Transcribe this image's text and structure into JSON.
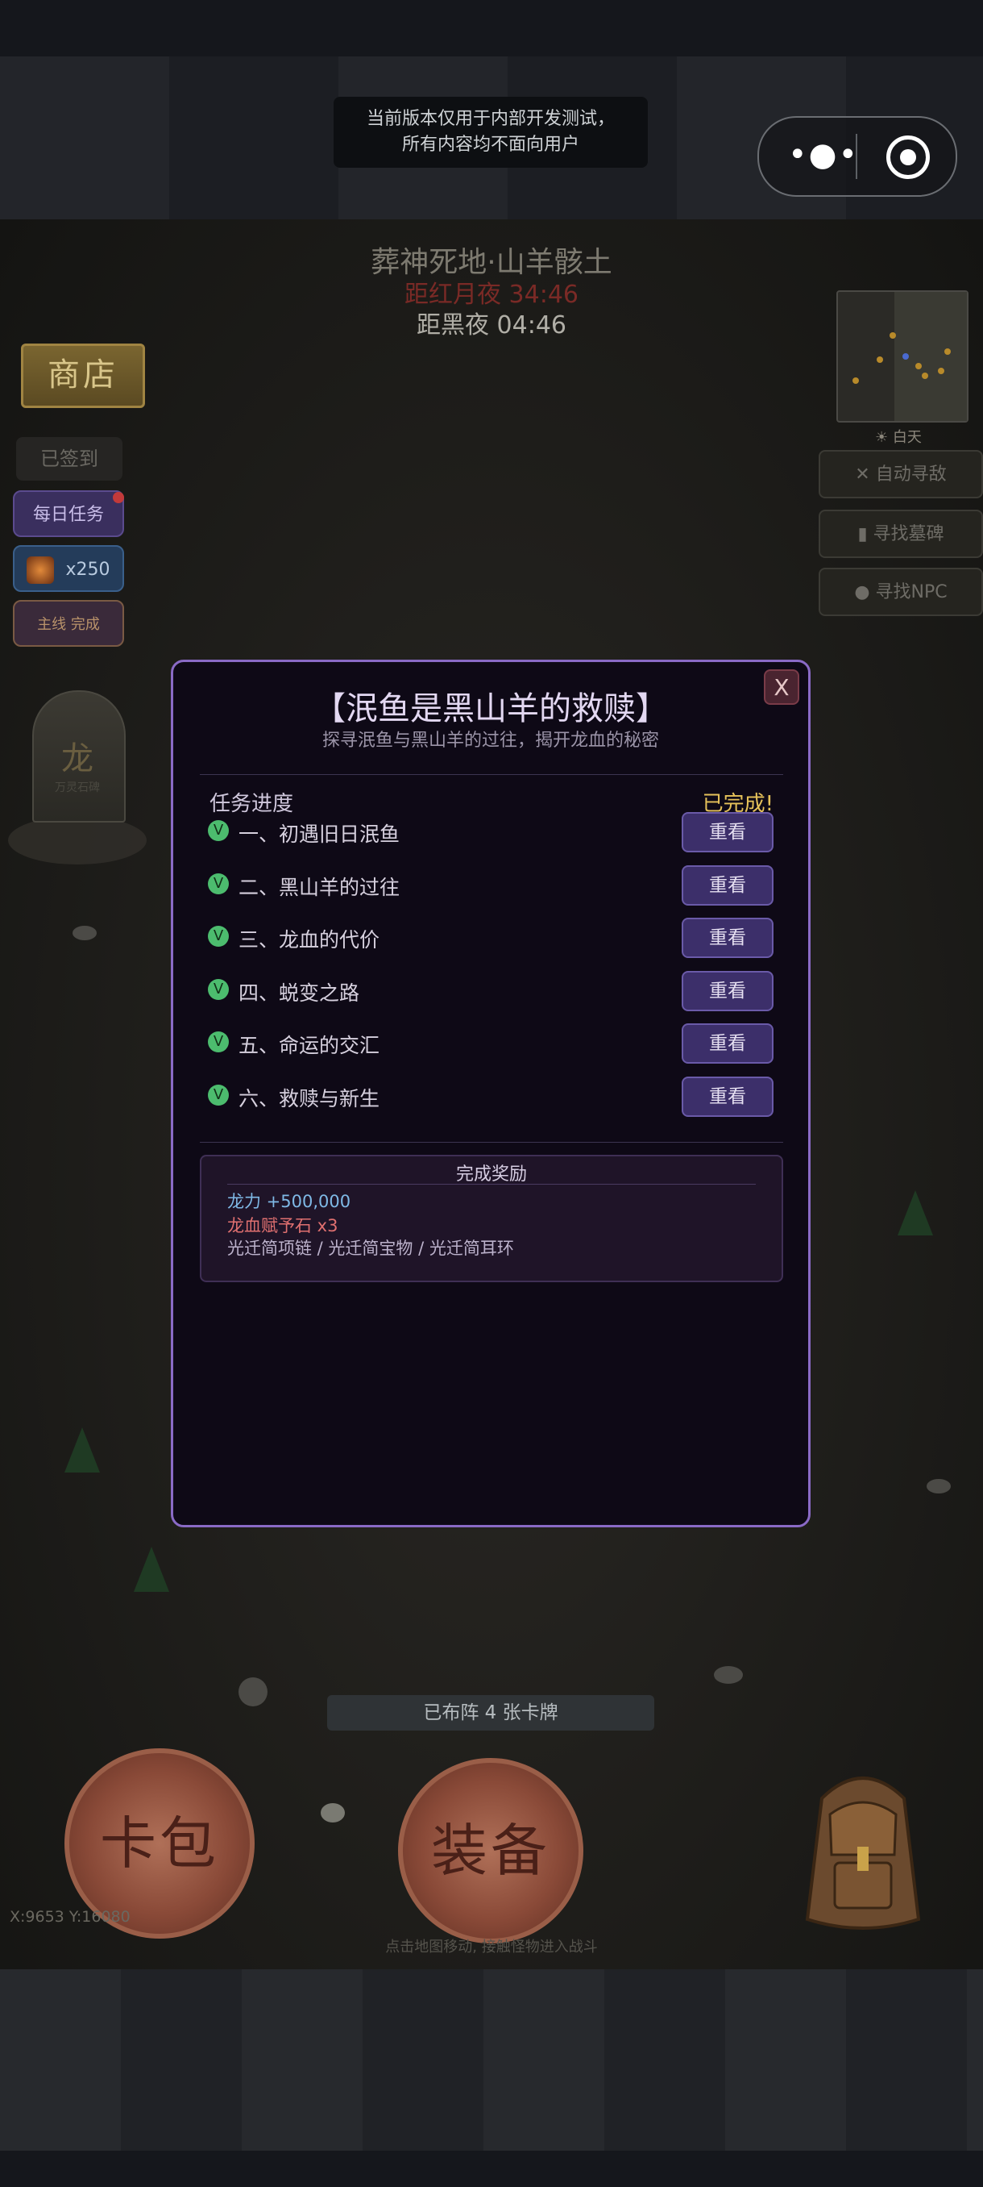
{
  "system": {
    "dev_notice_line1": "当前版本仅用于内部开发测试，",
    "dev_notice_line2": "所有内容均不面向用户",
    "menu_icon": "more-dots-icon",
    "close_icon": "target-icon"
  },
  "hud": {
    "area_name": "葬神死地·山羊骸土",
    "countdown_red": "距红月夜 34:46",
    "countdown_night": "距黑夜 04:46",
    "shop": "商店",
    "signed_in": "已签到",
    "daily_tasks": "每日任务",
    "gem_count": "x250",
    "main_quest": "主线 完成",
    "statue_char": "龙",
    "statue_caption": "万灵石碑",
    "day_label": "☀ 白天",
    "auto_find_enemy": "✕ 自动寻敌",
    "find_grave": "▮ 寻找墓碑",
    "find_npc": "● 寻找NPC"
  },
  "modal": {
    "close": "X",
    "title": "【泯鱼是黑山羊的救赎】",
    "subtitle": "探寻泯鱼与黑山羊的过往，揭开龙血的秘密",
    "progress_label": "任务进度",
    "progress_status": "已完成!",
    "quests": [
      {
        "check": "V",
        "name": "一、初遇旧日泯鱼",
        "button": "重看"
      },
      {
        "check": "V",
        "name": "二、黑山羊的过往",
        "button": "重看"
      },
      {
        "check": "V",
        "name": "三、龙血的代价",
        "button": "重看"
      },
      {
        "check": "V",
        "name": "四、蜕变之路",
        "button": "重看"
      },
      {
        "check": "V",
        "name": "五、命运的交汇",
        "button": "重看"
      },
      {
        "check": "V",
        "name": "六、救赎与新生",
        "button": "重看"
      }
    ],
    "rewards_title": "完成奖励",
    "rewards": [
      "龙力 +500,000",
      "龙血赋予石 x3",
      "光迁简项链 / 光迁简宝物 / 光迁简耳环"
    ]
  },
  "bottom": {
    "deck_status": "已布阵 4 张卡牌",
    "card_pack": "卡包",
    "equipment": "装备",
    "coords": "X:9653  Y:16080",
    "hint": "点击地图移动, 接触怪物进入战斗"
  },
  "colors": {
    "modal_border": "#8a6ac6",
    "complete_gold": "#e6c25a",
    "check_green": "#4cbc6e",
    "reward_blue": "#7fb9e6",
    "reward_red": "#e07070"
  }
}
